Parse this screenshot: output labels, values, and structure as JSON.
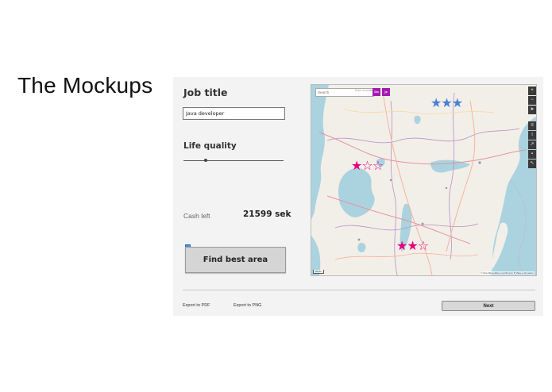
{
  "slide": {
    "title": "The Mockups"
  },
  "form": {
    "job_title_label": "Job title",
    "job_title_value": "Java developer",
    "life_quality_label": "Life quality",
    "life_quality_slider_fraction": 0.22,
    "cash_left_label": "Cash left",
    "cash_left_value": "21599 sek",
    "find_button_label": "Find best area"
  },
  "map": {
    "search_placeholder": "Search",
    "search_hint": "Enter a location",
    "go_label": "Go",
    "js_label": "js",
    "controls": [
      "zoom-in",
      "zoom-out",
      "locate",
      "layers",
      "info",
      "share",
      "note",
      "query"
    ],
    "control_glyphs": [
      "+",
      "−",
      "➤",
      "≡",
      "i",
      "↗",
      "▪",
      "↖"
    ],
    "attribution": "© OpenStreetMap contributors ♥ Make a Donation",
    "scale": "20 km",
    "colors": {
      "water": "#aad3df",
      "land": "#f2efe9",
      "star_pink": "#e6007e",
      "star_blue": "#4a7fd4",
      "accent": "#a21caf"
    },
    "ratings": [
      {
        "filled": 3,
        "total": 3,
        "color": "#4a7fd4"
      },
      {
        "filled": 1,
        "total": 3,
        "color": "#e6007e"
      },
      {
        "filled": 2,
        "total": 3,
        "color": "#e6007e"
      }
    ]
  },
  "footer": {
    "export_pdf": "Export to PDF",
    "export_png": "Export to PNG",
    "next_label": "Next"
  }
}
